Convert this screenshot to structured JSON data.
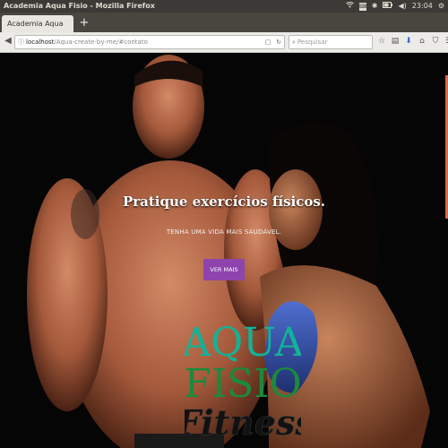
{
  "os_bar": {
    "window_title": "Academia Aqua Fisio - Mozilla Firefox",
    "clock": "23:04"
  },
  "tabs": [
    {
      "label": "Academia Aqua Fisio"
    }
  ],
  "new_tab_label": "+",
  "address_bar": {
    "host": "localhost",
    "path": "/Aqua-create-by-me/#contato"
  },
  "search_bar": {
    "placeholder": "Pesquisar"
  },
  "hero": {
    "headline": "Pratique exercícios físicos.",
    "subline": "TENHA UMA VIDA MAIS SAUDÁVEL.",
    "cta_label": "VER MAIS"
  },
  "logo": {
    "word1": "AQUA",
    "word2": "FISIO",
    "word3": "Fitness",
    "color_aqua": "#11b398",
    "color_fisio": "#1b8a3c",
    "color_fitness": "#111111"
  },
  "colors": {
    "cta": "#8e44ad",
    "os_bar": "#3b3a36",
    "tab_bar": "#47463f"
  },
  "icons": {
    "tray": [
      "wifi-icon",
      "keyboard-icon",
      "bluetooth-icon",
      "battery-icon",
      "volume-icon",
      "gear-icon"
    ],
    "toolbar": [
      "star-icon",
      "clipboard-icon",
      "download-icon",
      "home-icon",
      "shield-icon",
      "menu-icon"
    ]
  }
}
